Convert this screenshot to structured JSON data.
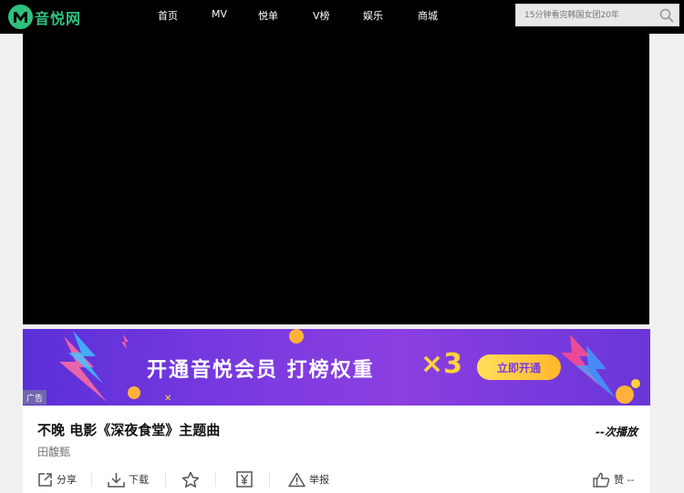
{
  "brand": {
    "name": "音悦网"
  },
  "nav": {
    "items": [
      "首页",
      "MV",
      "悦单",
      "V榜",
      "娱乐",
      "商城"
    ]
  },
  "search": {
    "placeholder": "15分钟看完韩国女团20年"
  },
  "ad": {
    "slogan": "开通音悦会员  打榜权重",
    "multiplier": "×3",
    "cta": "立即开通",
    "tag": "广告"
  },
  "video": {
    "title": "不晚 电影《深夜食堂》主题曲",
    "artist": "田馥甄",
    "plays": "--次播放"
  },
  "actions": {
    "share": "分享",
    "download": "下载",
    "report": "举报",
    "like": "赞 --"
  },
  "colors": {
    "brand": "#2ec27e",
    "ad_bg": "#7a3ae0",
    "ad_accent": "#ffd23c"
  }
}
